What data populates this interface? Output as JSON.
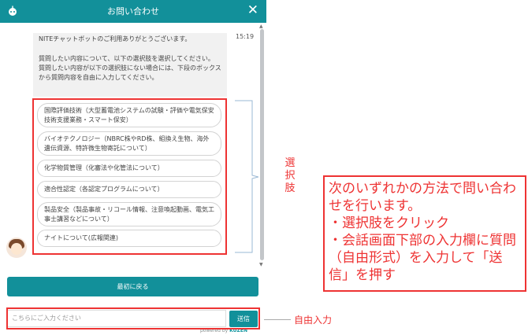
{
  "header": {
    "title": "お問い合わせ",
    "close_glyph": "✕",
    "bot_icon": "bot-icon",
    "color": "#12909a"
  },
  "message": {
    "line1": "NITEチャットボットのご利用ありがとうございます。",
    "line2": "質問したい内容について、以下の選択肢を選択してください。",
    "line3": "質問したい内容が以下の選択肢にない場合には、下段のボックスから質問内容を自由に入力してください。",
    "time": "15:19"
  },
  "choices": [
    "国際評価技術（大型蓄電池システムの試験・評価や電気保安技術支援業務・スマート保安）",
    "バイオテクノロジー（NBRC株やRD株、組換え生物、海外遺伝資源、特許微生物寄託について）",
    "化学物質管理（化審法や化管法について）",
    "適合性認定（各認定プログラムについて）",
    "製品安全（製品事故・リコール情報、注意喚起動画、電気工事士講習などについて）",
    "ナイトについて(広報関連)"
  ],
  "back_button": "最初に戻る",
  "input": {
    "placeholder": "こちらにご入力ください",
    "send_label": "送信"
  },
  "powered": {
    "prefix": "powered by ",
    "brand": "KUZEN"
  },
  "annotations": {
    "choices_label": "選択肢",
    "free_input_label": "自由入力",
    "note_lines": [
      "次のいずれかの方法で問い合わせを行います。",
      "・選択肢をクリック",
      "・会話画面下部の入力欄に質問（自由形式）を入力して「送信」を押す"
    ],
    "accent_color": "#e33333"
  }
}
